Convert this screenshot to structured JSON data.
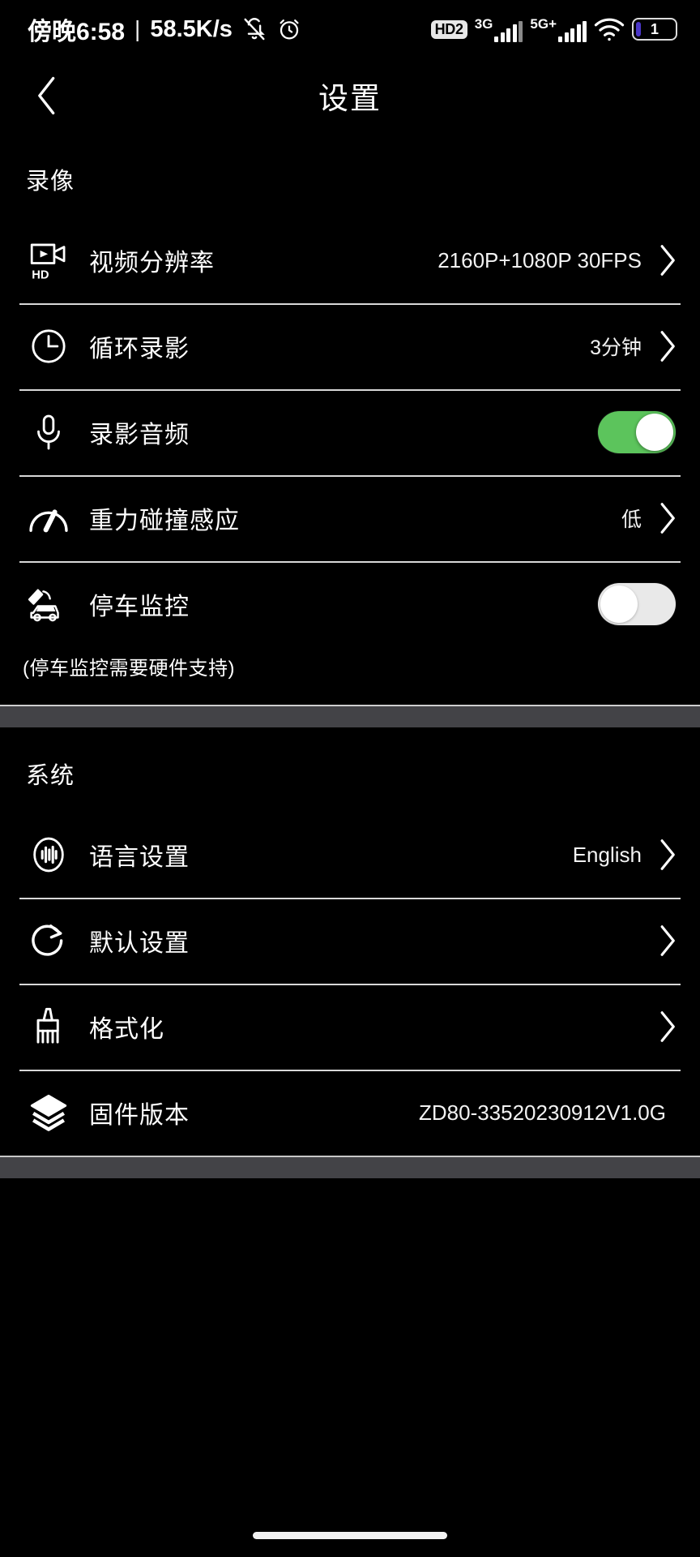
{
  "status_bar": {
    "clock": "傍晚6:58",
    "separator": "|",
    "network_speed": "58.5K/s",
    "mute_icon": "bell-muted-icon",
    "alarm_icon": "alarm-clock-icon",
    "hd2_label": "HD2",
    "sim1_label": "3G",
    "sim2_label": "5G+",
    "wifi_icon": "wifi-icon",
    "battery_level": "1"
  },
  "header": {
    "back_icon": "chevron-left-icon",
    "title": "设置"
  },
  "sections": [
    {
      "title": "录像",
      "rows": [
        {
          "icon": "hd-video-camera-icon",
          "label": "视频分辨率",
          "value": "2160P+1080P 30FPS",
          "control": "chevron"
        },
        {
          "icon": "clock-icon",
          "label": "循环录影",
          "value": "3分钟",
          "control": "chevron"
        },
        {
          "icon": "microphone-icon",
          "label": "录影音频",
          "value": "",
          "control": "toggle-on"
        },
        {
          "icon": "gauge-icon",
          "label": "重力碰撞感应",
          "value": "低",
          "control": "chevron"
        },
        {
          "icon": "parking-camera-car-icon",
          "label": "停车监控",
          "value": "",
          "control": "toggle-off"
        }
      ],
      "note": "(停车监控需要硬件支持)"
    },
    {
      "title": "系统",
      "rows": [
        {
          "icon": "voice-waveform-icon",
          "label": "语言设置",
          "value": "English",
          "control": "chevron"
        },
        {
          "icon": "restore-refresh-icon",
          "label": "默认设置",
          "value": "",
          "control": "chevron"
        },
        {
          "icon": "brush-icon",
          "label": "格式化",
          "value": "",
          "control": "chevron"
        },
        {
          "icon": "layers-icon",
          "label": "固件版本",
          "value": "ZD80-33520230912V1.0G",
          "control": "none"
        }
      ],
      "note": ""
    }
  ],
  "colors": {
    "background": "#000000",
    "toggle_on": "#5cc45c",
    "toggle_off": "#e9e9e9",
    "divider": "#d8d8d8",
    "gap_band": "#434347",
    "text": "#ffffff",
    "battery_fill": "#4b37c8"
  },
  "home_indicator": "home-indicator-bar"
}
